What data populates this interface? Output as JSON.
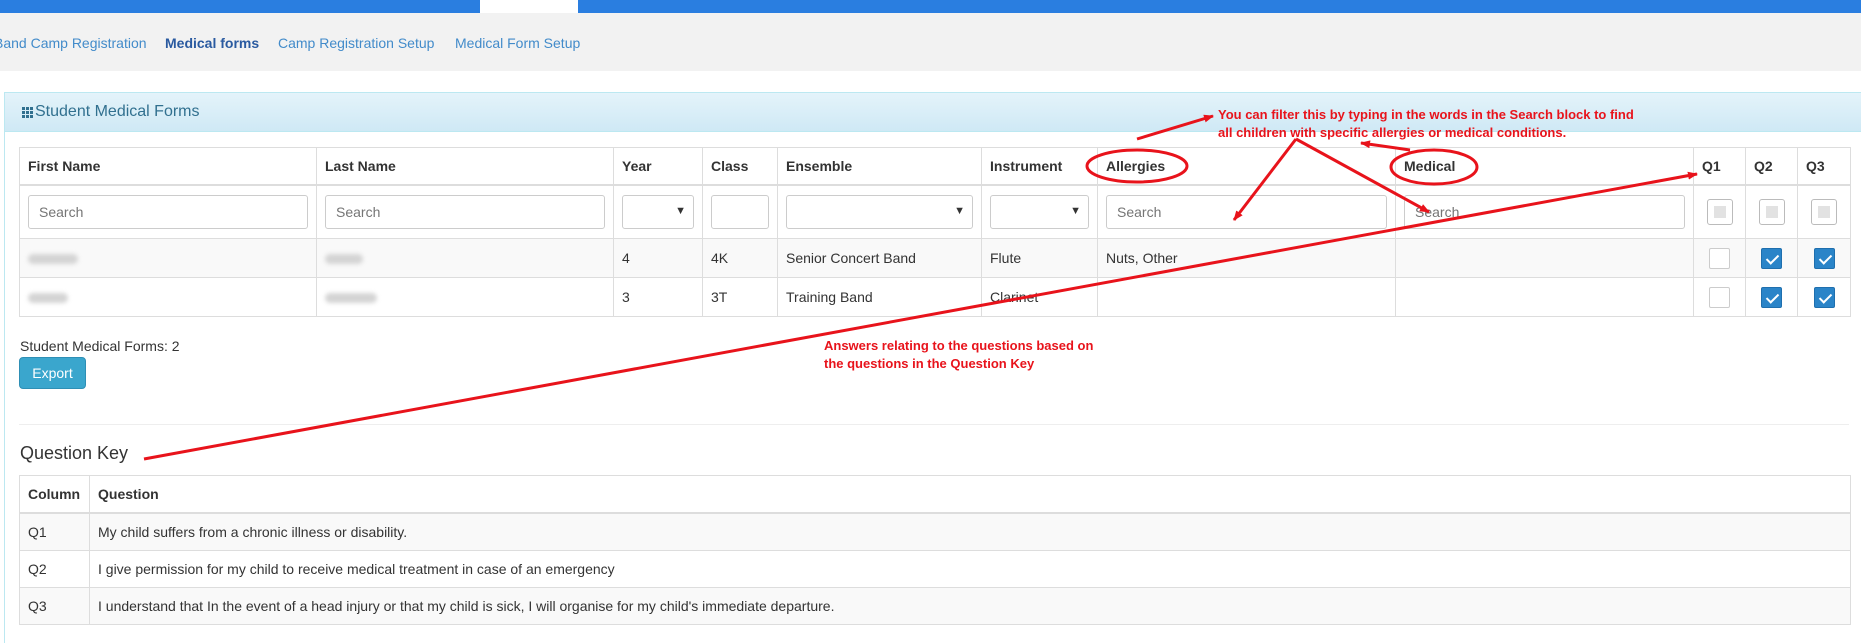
{
  "nav": {
    "items": [
      {
        "label": "Band Camp Registration",
        "active": false
      },
      {
        "label": "Medical forms",
        "active": true
      },
      {
        "label": "Camp Registration Setup",
        "active": false
      },
      {
        "label": "Medical Form Setup",
        "active": false
      }
    ]
  },
  "panel": {
    "title": "Student Medical Forms",
    "icon": "grid-icon"
  },
  "table": {
    "columns": [
      "First Name",
      "Last Name",
      "Year",
      "Class",
      "Ensemble",
      "Instrument",
      "Allergies",
      "Medical",
      "Q1",
      "Q2",
      "Q3"
    ],
    "search_placeholder": "Search",
    "rows": [
      {
        "year": "4",
        "class": "4K",
        "ensemble": "Senior Concert Band",
        "instrument": "Flute",
        "allergies": "Nuts, Other",
        "medical": "",
        "q1": false,
        "q2": true,
        "q3": true
      },
      {
        "year": "3",
        "class": "3T",
        "ensemble": "Training Band",
        "instrument": "Clarinet",
        "allergies": "",
        "medical": "",
        "q1": false,
        "q2": true,
        "q3": true
      }
    ]
  },
  "summary": {
    "count_text": "Student Medical Forms: 2",
    "export_label": "Export"
  },
  "question_key": {
    "title": "Question Key",
    "columns": [
      "Column",
      "Question"
    ],
    "rows": [
      {
        "col": "Q1",
        "question": "My child suffers from a chronic illness or disability."
      },
      {
        "col": "Q2",
        "question": "I give permission for my child to receive medical treatment in case of an emergency"
      },
      {
        "col": "Q3",
        "question": "I understand that In the event of a head injury or that my child is sick, I will organise for my child's immediate departure."
      }
    ]
  },
  "annotations": {
    "filter_note_line1": "You can filter this by typing in the words in the Search block to find",
    "filter_note_line2": "all children with specific allergies or medical conditions.",
    "answers_note_line1": "Answers relating to the questions based on",
    "answers_note_line2": "the questions in the Question Key",
    "color": "#e8131b"
  },
  "colors": {
    "topbar": "#2a7ee0",
    "accent": "#428bca",
    "checkbox_on": "#2a84c8",
    "export": "#3aa6cd"
  }
}
